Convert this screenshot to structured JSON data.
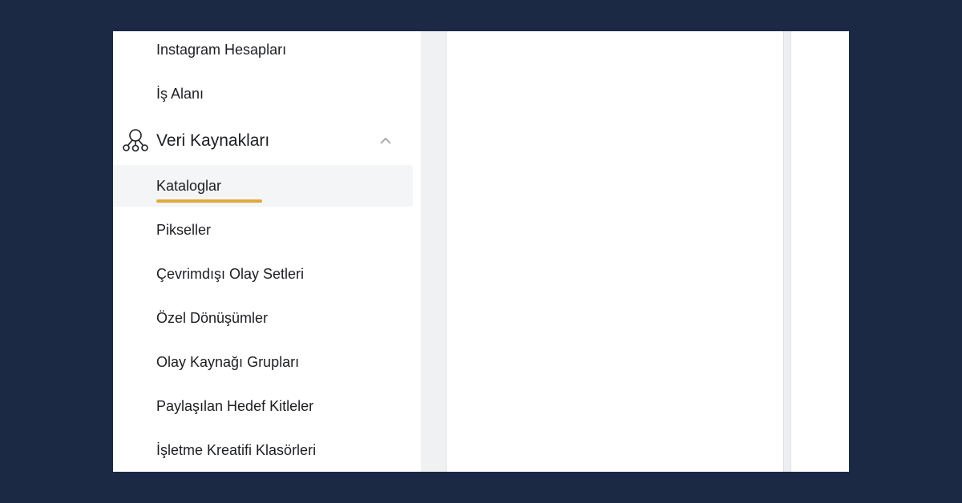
{
  "nav": {
    "items_top": [
      {
        "label": "Instagram Hesapları"
      },
      {
        "label": "İş Alanı"
      }
    ],
    "section": {
      "label": "Veri Kaynakları",
      "icon": "data-sources-icon",
      "expanded": true
    },
    "subitems": [
      {
        "label": "Kataloglar",
        "active": true
      },
      {
        "label": "Pikseller"
      },
      {
        "label": "Çevrimdışı Olay Setleri"
      },
      {
        "label": "Özel Dönüşümler"
      },
      {
        "label": "Olay Kaynağı Grupları"
      },
      {
        "label": "Paylaşılan Hedef Kitleler"
      },
      {
        "label": "İşletme Kreatifi Klasörleri"
      }
    ]
  },
  "colors": {
    "background": "#1b2945",
    "highlight": "#e0a93c",
    "active_bg": "#f3f5f6"
  }
}
